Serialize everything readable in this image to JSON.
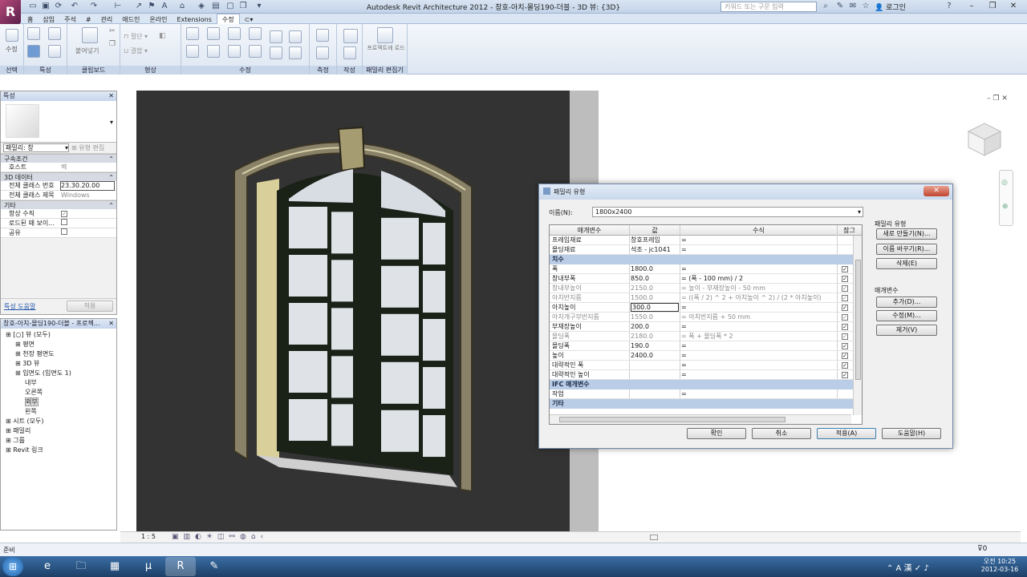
{
  "app": {
    "logo": "R",
    "title": "Autodesk Revit Architecture 2012 -    창호-아치-몰딩190-더블 - 3D 뷰: {3D}",
    "search_placeholder": "키워드 또는 구문 입력",
    "login": "로그인"
  },
  "tabs": [
    "홈",
    "삽입",
    "주석",
    "#",
    "관리",
    "애드인",
    "온라인",
    "Extensions",
    "수정"
  ],
  "active_tab": "수정",
  "ribbon_groups": [
    "선택",
    "특성",
    "클립보드",
    "형상",
    "수정",
    "측정",
    "작성",
    "패밀리 편집기"
  ],
  "ribbon_labels": {
    "modify": "수정",
    "paste": "붙여넣기",
    "load_project": "프로젝트에 로드"
  },
  "properties": {
    "header": "특성",
    "type_selector": "패밀리: 창",
    "edit_type": "유형 편집",
    "sections": [
      {
        "title": "구속조건",
        "rows": [
          {
            "k": "호스트",
            "v": "벽"
          }
        ]
      },
      {
        "title": "3D 데이터",
        "rows": [
          {
            "k": "전체 클래스 번호",
            "v": "23.30.20.00"
          },
          {
            "k": "전체 클래스 제목",
            "v": "Windows"
          }
        ]
      },
      {
        "title": "기타",
        "rows": [
          {
            "k": "항상 수직",
            "v": "check"
          },
          {
            "k": "로드된 때 보이...",
            "v": "box"
          },
          {
            "k": "공유",
            "v": "box"
          }
        ]
      }
    ],
    "help_link": "특성 도움말",
    "apply": "적용"
  },
  "browser": {
    "header": "창호-아치-몰딩190-더블 - 프로젝...",
    "items": [
      {
        "t": "[○] 뷰 (모두)",
        "d": 0
      },
      {
        "t": "평면",
        "d": 1
      },
      {
        "t": "천장 평면도",
        "d": 1
      },
      {
        "t": "3D 뷰",
        "d": 1
      },
      {
        "t": "입면도 (입면도 1)",
        "d": 1
      },
      {
        "t": "내부",
        "d": 2
      },
      {
        "t": "오른쪽",
        "d": 2
      },
      {
        "t": "외부",
        "d": 2
      },
      {
        "t": "왼쪽",
        "d": 2
      },
      {
        "t": "시트 (모두)",
        "d": 0
      },
      {
        "t": "패밀리",
        "d": 0
      },
      {
        "t": "그룹",
        "d": 0
      },
      {
        "t": "Revit 링크",
        "d": 0
      }
    ]
  },
  "viewbar": {
    "scale": "1 : 5"
  },
  "status": {
    "text": "준비",
    "filter_count": "0"
  },
  "taskbar": {
    "time": "오전 10:25",
    "date": "2012-03-16"
  },
  "dialog": {
    "title": "패밀리 유형",
    "name_label": "이름(N):",
    "name_value": "1800x2400",
    "columns": [
      "매개변수",
      "값",
      "수식",
      "잠그"
    ],
    "rows": [
      {
        "kind": "row",
        "p": "프레임재료",
        "v": "창호프레임",
        "f": "=",
        "lock": false,
        "grey": false
      },
      {
        "kind": "row",
        "p": "몰딩재료",
        "v": "석조 - jc1041",
        "f": "=",
        "lock": false,
        "grey": false
      },
      {
        "kind": "group",
        "p": "치수"
      },
      {
        "kind": "row",
        "p": "폭",
        "v": "1800.0",
        "f": "=",
        "lock": true,
        "grey": false
      },
      {
        "kind": "row",
        "p": "창내부폭",
        "v": "850.0",
        "f": "= (폭 - 100 mm) / 2",
        "lock": true,
        "grey": false
      },
      {
        "kind": "row",
        "p": "창내부높이",
        "v": "2150.0",
        "f": "= 높이 - 부재장높이 - 50 mm",
        "lock": true,
        "grey": true
      },
      {
        "kind": "row",
        "p": "아치반지름",
        "v": "1500.0",
        "f": "= ((폭 / 2) ^ 2 + 아치높이 ^ 2) / (2 * 아치높이)",
        "lock": true,
        "grey": true
      },
      {
        "kind": "row",
        "p": "아치높이",
        "v": "300.0",
        "f": "=",
        "lock": true,
        "grey": false,
        "edit": true
      },
      {
        "kind": "row",
        "p": "아치개구부반지름",
        "v": "1550.0",
        "f": "= 아치반지름 + 50 mm",
        "lock": true,
        "grey": true
      },
      {
        "kind": "row",
        "p": "부재장높이",
        "v": "200.0",
        "f": "=",
        "lock": true,
        "grey": false
      },
      {
        "kind": "row",
        "p": "몰딩폭",
        "v": "2180.0",
        "f": "= 폭 + 몰딩폭 * 2",
        "lock": true,
        "grey": true
      },
      {
        "kind": "row",
        "p": "몰딩폭",
        "v": "190.0",
        "f": "=",
        "lock": true,
        "grey": false
      },
      {
        "kind": "row",
        "p": "높이",
        "v": "2400.0",
        "f": "=",
        "lock": true,
        "grey": false
      },
      {
        "kind": "row",
        "p": "대략적인 폭",
        "v": "",
        "f": "=",
        "lock": true,
        "grey": false
      },
      {
        "kind": "row",
        "p": "대략적인 높이",
        "v": "",
        "f": "=",
        "lock": true,
        "grey": false
      },
      {
        "kind": "group",
        "p": "IFC 매개변수"
      },
      {
        "kind": "row",
        "p": "작업",
        "v": "",
        "f": "=",
        "lock": false,
        "grey": false
      },
      {
        "kind": "group",
        "p": "기타"
      }
    ],
    "family_types_label": "패밀리 유형",
    "new_btn": "새로 만들기(N)...",
    "rename_btn": "이름 바꾸기(R)...",
    "delete_btn": "삭제(E)",
    "params_label": "매개변수",
    "add_btn": "추가(D)...",
    "modify_btn": "수정(M)...",
    "remove_btn": "제거(V)",
    "ok": "확인",
    "cancel": "취소",
    "apply": "적용(A)",
    "help": "도움말(H)"
  }
}
